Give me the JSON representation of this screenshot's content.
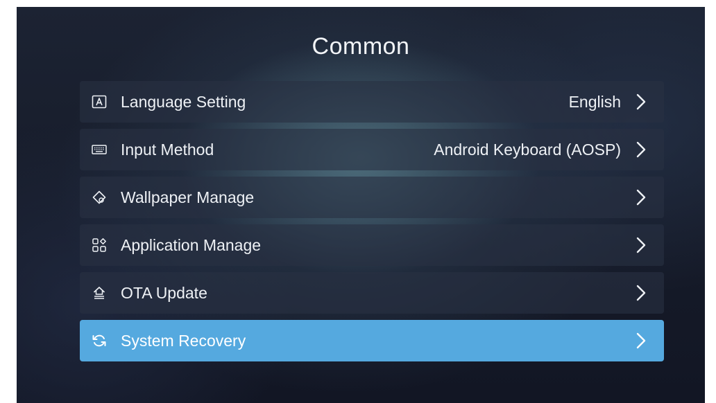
{
  "page": {
    "title": "Common"
  },
  "menu": {
    "items": [
      {
        "label": "Language Setting",
        "value": "English",
        "icon": "language-icon",
        "selected": false
      },
      {
        "label": "Input Method",
        "value": "Android Keyboard (AOSP)",
        "icon": "keyboard-icon",
        "selected": false
      },
      {
        "label": "Wallpaper Manage",
        "value": "",
        "icon": "paint-bucket-icon",
        "selected": false
      },
      {
        "label": "Application Manage",
        "value": "",
        "icon": "apps-grid-icon",
        "selected": false
      },
      {
        "label": "OTA Update",
        "value": "",
        "icon": "update-house-icon",
        "selected": false
      },
      {
        "label": "System Recovery",
        "value": "",
        "icon": "recovery-refresh-icon",
        "selected": true
      }
    ]
  },
  "colors": {
    "selected_background": "#55a9df",
    "item_background": "#283042",
    "text": "#eef1f5"
  }
}
